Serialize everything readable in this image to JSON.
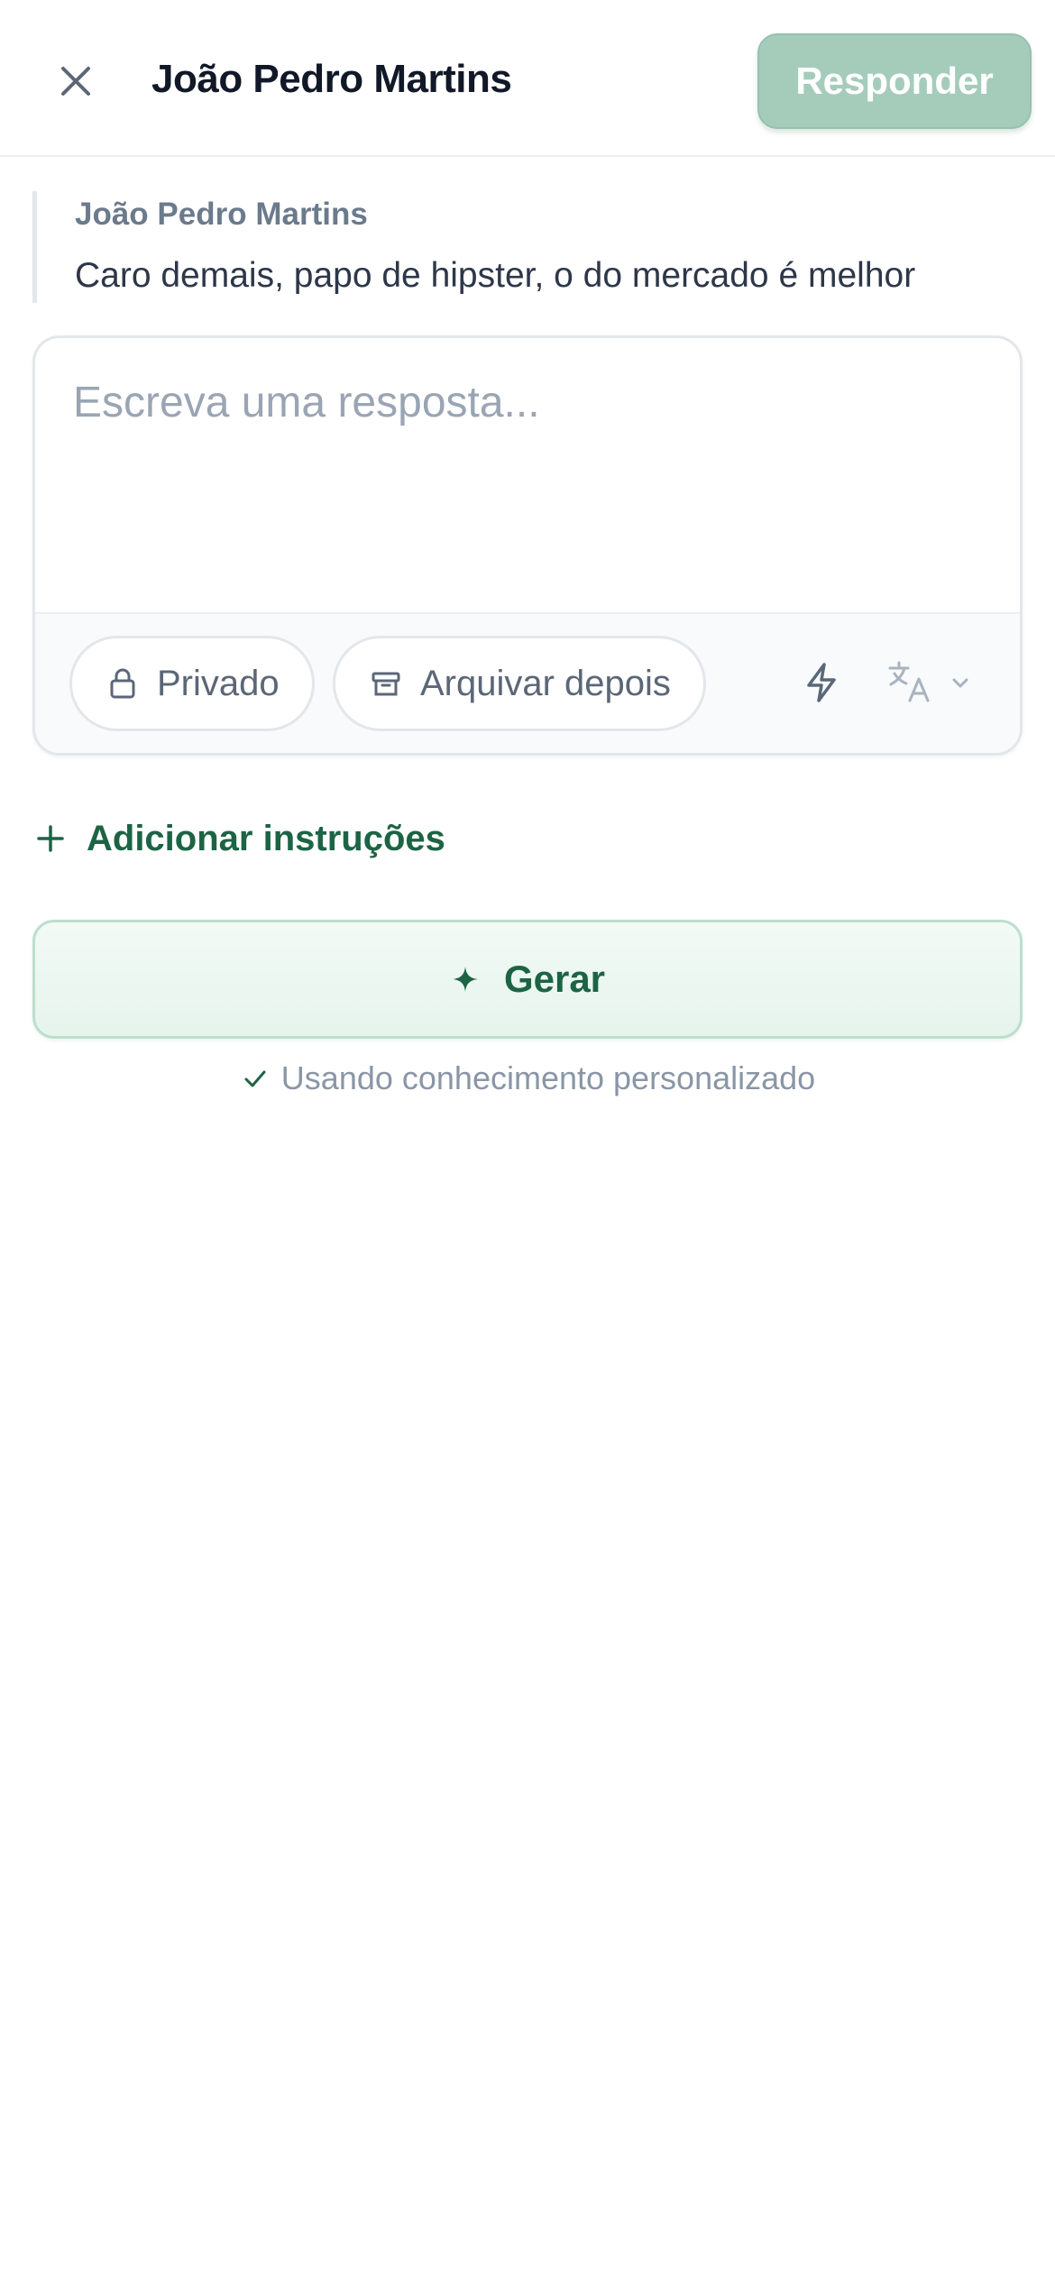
{
  "header": {
    "title": "João Pedro Martins",
    "close_icon": "close-icon",
    "reply_label": "Responder"
  },
  "quote": {
    "author": "João Pedro Martins",
    "text": "Caro demais, papo de hipster, o do mercado é melhor"
  },
  "composer": {
    "value": "",
    "placeholder": "Escreva uma resposta...",
    "private_label": "Privado",
    "private_icon": "lock-icon",
    "archive_label": "Arquivar depois",
    "archive_icon": "archive-box-icon",
    "bolt_icon": "bolt-icon",
    "translate_icon": "translate-icon"
  },
  "instructions": {
    "add_label": "Adicionar instruções",
    "icon": "plus-icon"
  },
  "generate": {
    "label": "Gerar",
    "icon": "sparkle-icon"
  },
  "knowledge": {
    "label": "Usando conhecimento personalizado",
    "icon": "check-icon"
  },
  "colors": {
    "accent": "#1c6444",
    "reply_button_disabled": "#a5ccbb",
    "generate_bg": "#e6f4ec",
    "muted_text": "#8a96a6"
  }
}
